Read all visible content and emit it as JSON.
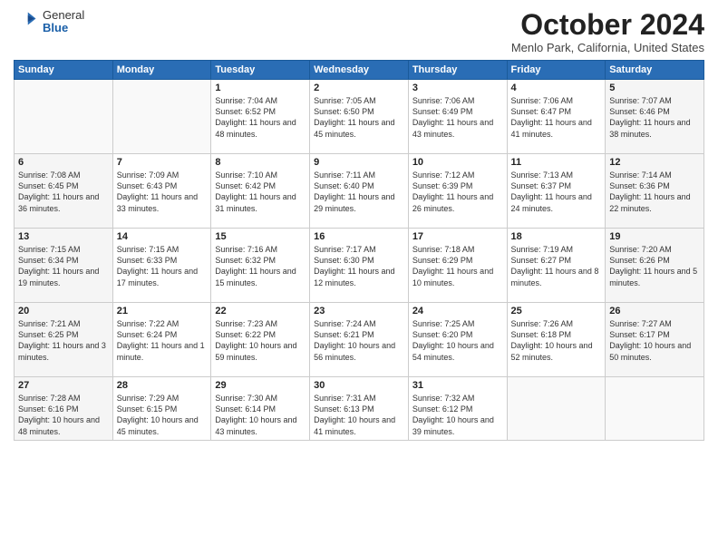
{
  "header": {
    "logo": {
      "general": "General",
      "blue": "Blue"
    },
    "title": "October 2024",
    "subtitle": "Menlo Park, California, United States"
  },
  "days_of_week": [
    "Sunday",
    "Monday",
    "Tuesday",
    "Wednesday",
    "Thursday",
    "Friday",
    "Saturday"
  ],
  "weeks": [
    [
      {
        "day": "",
        "info": ""
      },
      {
        "day": "",
        "info": ""
      },
      {
        "day": "1",
        "info": "Sunrise: 7:04 AM\nSunset: 6:52 PM\nDaylight: 11 hours and 48 minutes."
      },
      {
        "day": "2",
        "info": "Sunrise: 7:05 AM\nSunset: 6:50 PM\nDaylight: 11 hours and 45 minutes."
      },
      {
        "day": "3",
        "info": "Sunrise: 7:06 AM\nSunset: 6:49 PM\nDaylight: 11 hours and 43 minutes."
      },
      {
        "day": "4",
        "info": "Sunrise: 7:06 AM\nSunset: 6:47 PM\nDaylight: 11 hours and 41 minutes."
      },
      {
        "day": "5",
        "info": "Sunrise: 7:07 AM\nSunset: 6:46 PM\nDaylight: 11 hours and 38 minutes."
      }
    ],
    [
      {
        "day": "6",
        "info": "Sunrise: 7:08 AM\nSunset: 6:45 PM\nDaylight: 11 hours and 36 minutes."
      },
      {
        "day": "7",
        "info": "Sunrise: 7:09 AM\nSunset: 6:43 PM\nDaylight: 11 hours and 33 minutes."
      },
      {
        "day": "8",
        "info": "Sunrise: 7:10 AM\nSunset: 6:42 PM\nDaylight: 11 hours and 31 minutes."
      },
      {
        "day": "9",
        "info": "Sunrise: 7:11 AM\nSunset: 6:40 PM\nDaylight: 11 hours and 29 minutes."
      },
      {
        "day": "10",
        "info": "Sunrise: 7:12 AM\nSunset: 6:39 PM\nDaylight: 11 hours and 26 minutes."
      },
      {
        "day": "11",
        "info": "Sunrise: 7:13 AM\nSunset: 6:37 PM\nDaylight: 11 hours and 24 minutes."
      },
      {
        "day": "12",
        "info": "Sunrise: 7:14 AM\nSunset: 6:36 PM\nDaylight: 11 hours and 22 minutes."
      }
    ],
    [
      {
        "day": "13",
        "info": "Sunrise: 7:15 AM\nSunset: 6:34 PM\nDaylight: 11 hours and 19 minutes."
      },
      {
        "day": "14",
        "info": "Sunrise: 7:15 AM\nSunset: 6:33 PM\nDaylight: 11 hours and 17 minutes."
      },
      {
        "day": "15",
        "info": "Sunrise: 7:16 AM\nSunset: 6:32 PM\nDaylight: 11 hours and 15 minutes."
      },
      {
        "day": "16",
        "info": "Sunrise: 7:17 AM\nSunset: 6:30 PM\nDaylight: 11 hours and 12 minutes."
      },
      {
        "day": "17",
        "info": "Sunrise: 7:18 AM\nSunset: 6:29 PM\nDaylight: 11 hours and 10 minutes."
      },
      {
        "day": "18",
        "info": "Sunrise: 7:19 AM\nSunset: 6:27 PM\nDaylight: 11 hours and 8 minutes."
      },
      {
        "day": "19",
        "info": "Sunrise: 7:20 AM\nSunset: 6:26 PM\nDaylight: 11 hours and 5 minutes."
      }
    ],
    [
      {
        "day": "20",
        "info": "Sunrise: 7:21 AM\nSunset: 6:25 PM\nDaylight: 11 hours and 3 minutes."
      },
      {
        "day": "21",
        "info": "Sunrise: 7:22 AM\nSunset: 6:24 PM\nDaylight: 11 hours and 1 minute."
      },
      {
        "day": "22",
        "info": "Sunrise: 7:23 AM\nSunset: 6:22 PM\nDaylight: 10 hours and 59 minutes."
      },
      {
        "day": "23",
        "info": "Sunrise: 7:24 AM\nSunset: 6:21 PM\nDaylight: 10 hours and 56 minutes."
      },
      {
        "day": "24",
        "info": "Sunrise: 7:25 AM\nSunset: 6:20 PM\nDaylight: 10 hours and 54 minutes."
      },
      {
        "day": "25",
        "info": "Sunrise: 7:26 AM\nSunset: 6:18 PM\nDaylight: 10 hours and 52 minutes."
      },
      {
        "day": "26",
        "info": "Sunrise: 7:27 AM\nSunset: 6:17 PM\nDaylight: 10 hours and 50 minutes."
      }
    ],
    [
      {
        "day": "27",
        "info": "Sunrise: 7:28 AM\nSunset: 6:16 PM\nDaylight: 10 hours and 48 minutes."
      },
      {
        "day": "28",
        "info": "Sunrise: 7:29 AM\nSunset: 6:15 PM\nDaylight: 10 hours and 45 minutes."
      },
      {
        "day": "29",
        "info": "Sunrise: 7:30 AM\nSunset: 6:14 PM\nDaylight: 10 hours and 43 minutes."
      },
      {
        "day": "30",
        "info": "Sunrise: 7:31 AM\nSunset: 6:13 PM\nDaylight: 10 hours and 41 minutes."
      },
      {
        "day": "31",
        "info": "Sunrise: 7:32 AM\nSunset: 6:12 PM\nDaylight: 10 hours and 39 minutes."
      },
      {
        "day": "",
        "info": ""
      },
      {
        "day": "",
        "info": ""
      }
    ]
  ]
}
